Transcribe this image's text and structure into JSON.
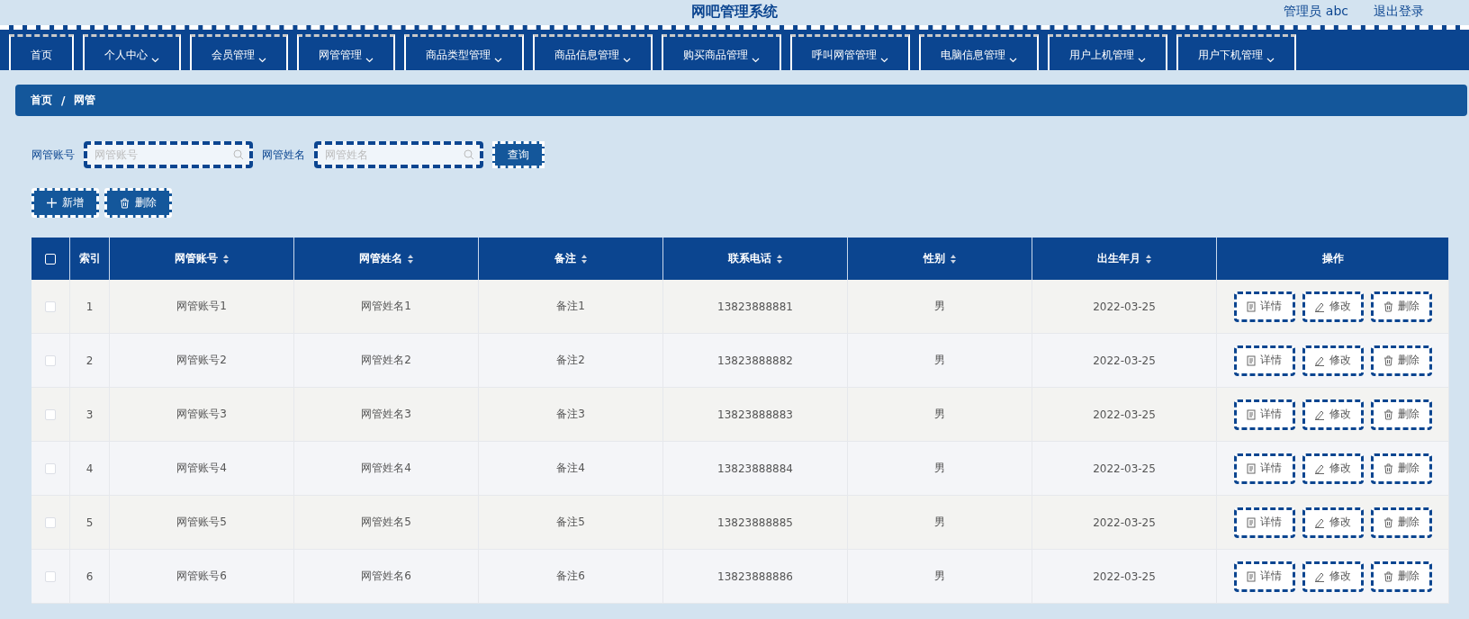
{
  "header": {
    "title": "网吧管理系统",
    "user": "管理员 abc",
    "logout": "退出登录"
  },
  "nav": [
    {
      "label": "首页",
      "dropdown": false
    },
    {
      "label": "个人中心",
      "dropdown": true
    },
    {
      "label": "会员管理",
      "dropdown": true
    },
    {
      "label": "网管管理",
      "dropdown": true
    },
    {
      "label": "商品类型管理",
      "dropdown": true
    },
    {
      "label": "商品信息管理",
      "dropdown": true
    },
    {
      "label": "购买商品管理",
      "dropdown": true
    },
    {
      "label": "呼叫网管管理",
      "dropdown": true
    },
    {
      "label": "电脑信息管理",
      "dropdown": true
    },
    {
      "label": "用户上机管理",
      "dropdown": true
    },
    {
      "label": "用户下机管理",
      "dropdown": true
    }
  ],
  "breadcrumb": {
    "items": [
      "首页",
      "网管"
    ],
    "separator": "/"
  },
  "search": {
    "fields": [
      {
        "label": "网管账号",
        "placeholder": "网管账号"
      },
      {
        "label": "网管姓名",
        "placeholder": "网管姓名"
      }
    ],
    "button": "查询"
  },
  "actions": [
    {
      "kind": "add",
      "label": "新增"
    },
    {
      "kind": "delete",
      "label": "删除"
    }
  ],
  "table": {
    "all_checked": false,
    "columns": [
      {
        "label": "索引",
        "sortable": false
      },
      {
        "label": "网管账号",
        "sortable": true
      },
      {
        "label": "网管姓名",
        "sortable": true
      },
      {
        "label": "备注",
        "sortable": true
      },
      {
        "label": "联系电话",
        "sortable": true
      },
      {
        "label": "性别",
        "sortable": true
      },
      {
        "label": "出生年月",
        "sortable": true
      },
      {
        "label": "操作",
        "sortable": false
      }
    ],
    "rows": [
      {
        "checked": false,
        "cells": [
          "1",
          "网管账号1",
          "网管姓名1",
          "备注1",
          "13823888881",
          "男",
          "2022-03-25"
        ],
        "buttons": [
          {
            "kind": "detail",
            "label": "详情"
          },
          {
            "kind": "edit",
            "label": "修改"
          },
          {
            "kind": "delete",
            "label": "删除"
          }
        ]
      },
      {
        "checked": false,
        "cells": [
          "2",
          "网管账号2",
          "网管姓名2",
          "备注2",
          "13823888882",
          "男",
          "2022-03-25"
        ],
        "buttons": [
          {
            "kind": "detail",
            "label": "详情"
          },
          {
            "kind": "edit",
            "label": "修改"
          },
          {
            "kind": "delete",
            "label": "删除"
          }
        ]
      },
      {
        "checked": false,
        "cells": [
          "3",
          "网管账号3",
          "网管姓名3",
          "备注3",
          "13823888883",
          "男",
          "2022-03-25"
        ],
        "buttons": [
          {
            "kind": "detail",
            "label": "详情"
          },
          {
            "kind": "edit",
            "label": "修改"
          },
          {
            "kind": "delete",
            "label": "删除"
          }
        ]
      },
      {
        "checked": false,
        "cells": [
          "4",
          "网管账号4",
          "网管姓名4",
          "备注4",
          "13823888884",
          "男",
          "2022-03-25"
        ],
        "buttons": [
          {
            "kind": "detail",
            "label": "详情"
          },
          {
            "kind": "edit",
            "label": "修改"
          },
          {
            "kind": "delete",
            "label": "删除"
          }
        ]
      },
      {
        "checked": false,
        "cells": [
          "5",
          "网管账号5",
          "网管姓名5",
          "备注5",
          "13823888885",
          "男",
          "2022-03-25"
        ],
        "buttons": [
          {
            "kind": "detail",
            "label": "详情"
          },
          {
            "kind": "edit",
            "label": "修改"
          },
          {
            "kind": "delete",
            "label": "删除"
          }
        ]
      },
      {
        "checked": false,
        "cells": [
          "6",
          "网管账号6",
          "网管姓名6",
          "备注6",
          "13823888886",
          "男",
          "2022-03-25"
        ],
        "buttons": [
          {
            "kind": "detail",
            "label": "详情"
          },
          {
            "kind": "edit",
            "label": "修改"
          },
          {
            "kind": "delete",
            "label": "删除"
          }
        ]
      }
    ]
  }
}
